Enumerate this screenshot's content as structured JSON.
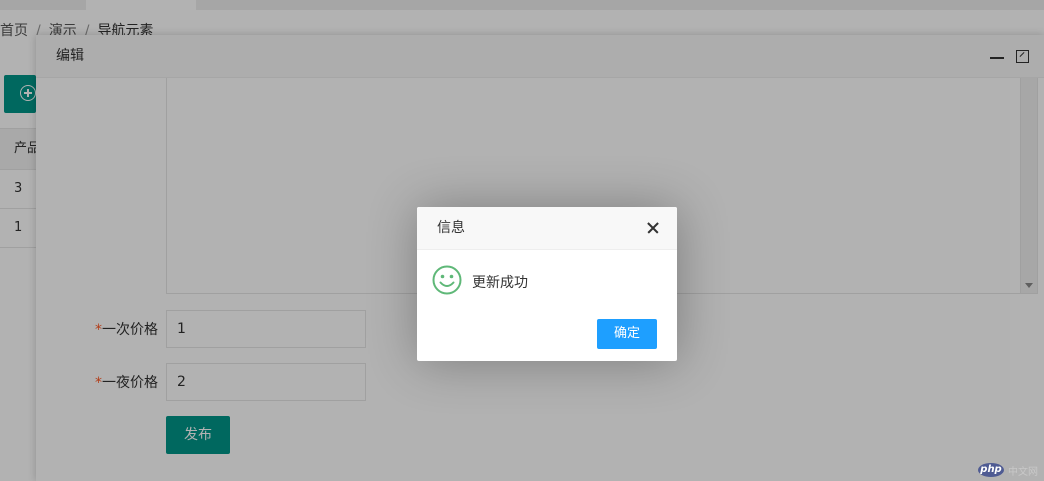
{
  "breadcrumb": {
    "items": [
      "首页",
      "演示",
      "导航元素"
    ],
    "separator": "/"
  },
  "background_table": {
    "header": "产品",
    "rows": [
      "3",
      "1"
    ]
  },
  "edit_layer": {
    "title": "编辑",
    "fields": [
      {
        "label": "一次价格",
        "required_mark": "*",
        "value": "1"
      },
      {
        "label": "一夜价格",
        "required_mark": "*",
        "value": "2"
      }
    ],
    "publish_label": "发布"
  },
  "dialog": {
    "title": "信息",
    "message": "更新成功",
    "icon": "smile-icon",
    "ok_label": "确定"
  },
  "watermark": {
    "logo_text": "php",
    "text": "中文网"
  },
  "colors": {
    "primary_green": "#009688",
    "button_blue": "#1e9fff",
    "success_icon": "#5fb878",
    "required": "#ff5722"
  }
}
